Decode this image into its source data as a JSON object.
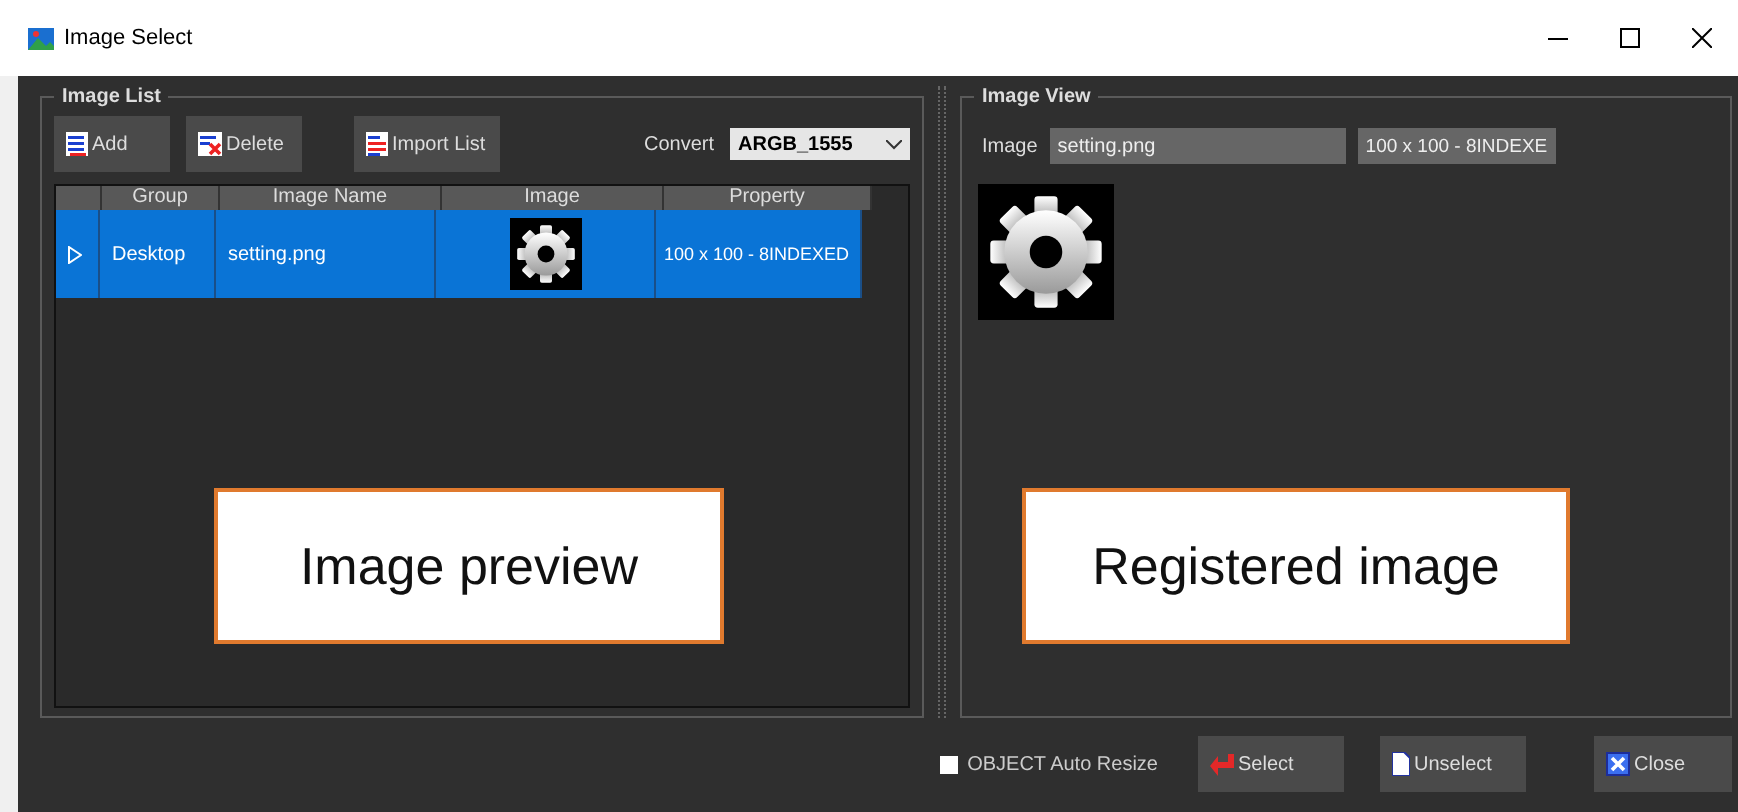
{
  "window": {
    "title": "Image Select"
  },
  "image_list": {
    "title": "Image List",
    "buttons": [
      {
        "label": "Add",
        "kind": "add"
      },
      {
        "label": "Delete",
        "kind": "delete"
      },
      {
        "label": "Import List",
        "kind": "import"
      }
    ],
    "convert": {
      "label": "Convert",
      "value": "ARGB_1555"
    },
    "columns": [
      "Group",
      "Image Name",
      "Image",
      "Property"
    ],
    "rows": [
      {
        "group": "Desktop",
        "name": "setting.png",
        "property": "100 x 100 - 8INDEXED",
        "selected": true
      }
    ]
  },
  "image_view": {
    "title": "Image View",
    "label": "Image",
    "name": "setting.png",
    "property": "100 x 100 - 8INDEXE"
  },
  "callouts": [
    {
      "text": "Image preview"
    },
    {
      "text": "Registered image"
    }
  ],
  "footer": {
    "checkbox": {
      "label": "OBJECT Auto Resize",
      "checked": false
    },
    "buttons": [
      {
        "label": "Select",
        "kind": "select"
      },
      {
        "label": "Unselect",
        "kind": "unselect"
      },
      {
        "label": "Close",
        "kind": "close"
      }
    ]
  }
}
